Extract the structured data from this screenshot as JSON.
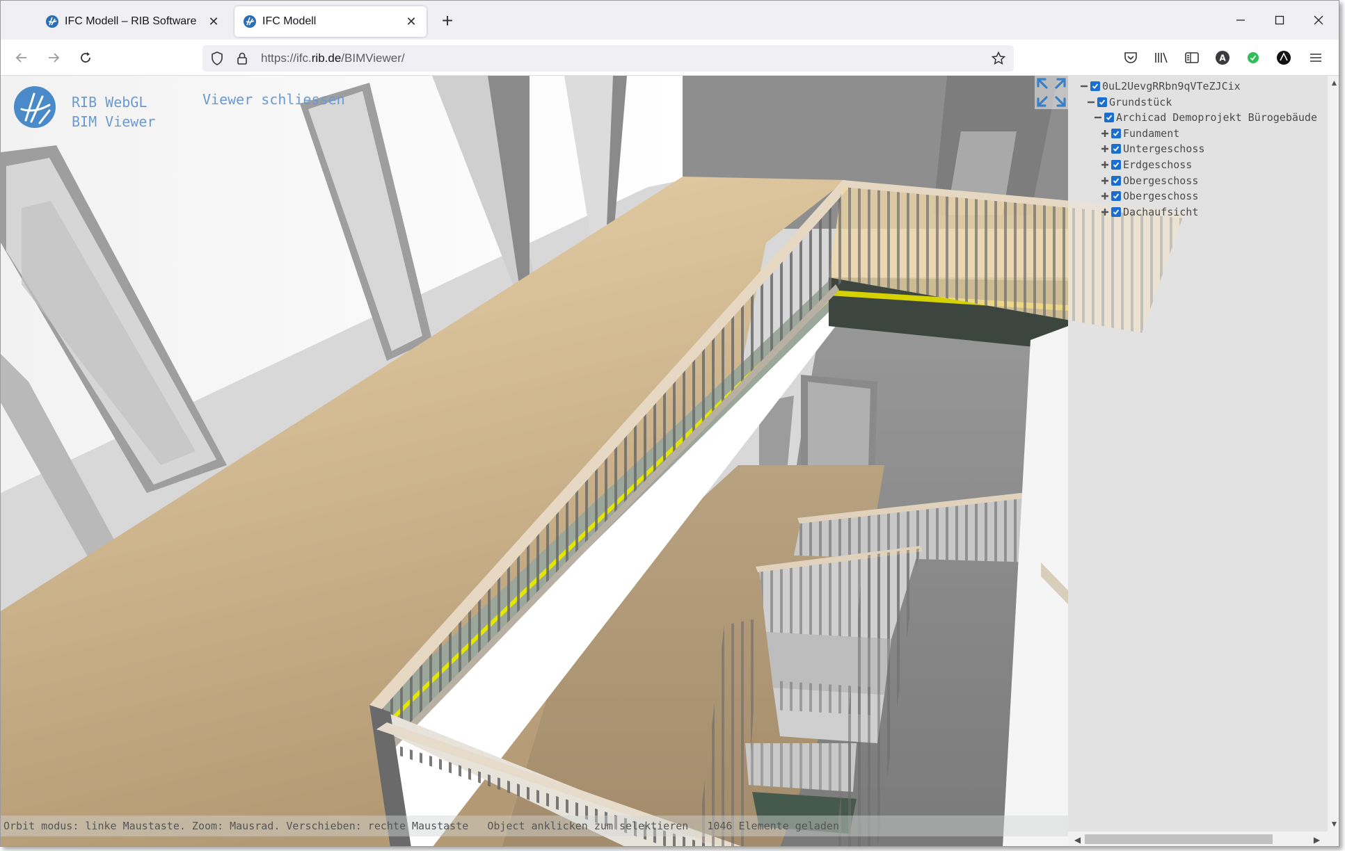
{
  "browser": {
    "tabs": [
      {
        "label": "IFC Modell – RIB Software",
        "active": false
      },
      {
        "label": "IFC Modell",
        "active": true
      }
    ],
    "url_host": "https://ifc.",
    "url_domain": "rib.de",
    "url_path": "/BIMViewer/",
    "toolbar_icons": [
      "pocket-icon",
      "library-icon",
      "sidebar-icon",
      "account-icon",
      "extension-icon",
      "profile-icon",
      "menu-icon"
    ]
  },
  "viewer": {
    "brand_line1": "RIB WebGL",
    "brand_line2": "BIM Viewer",
    "close_label": "Viewer schliessen",
    "accent_color": "#6a9ad0"
  },
  "tree": [
    {
      "label": "0uL2UevgRRbn9qVTeZJCix",
      "toggle": "−",
      "level": 0
    },
    {
      "label": "Grundstück",
      "toggle": "−",
      "level": 1
    },
    {
      "label": "Archicad Demoprojekt Bürogebäude",
      "toggle": "−",
      "level": 2
    },
    {
      "label": "Fundament",
      "toggle": "+",
      "level": 3
    },
    {
      "label": "Untergeschoss",
      "toggle": "+",
      "level": 3
    },
    {
      "label": "Erdgeschoss",
      "toggle": "+",
      "level": 3
    },
    {
      "label": "Obergeschoss",
      "toggle": "+",
      "level": 3
    },
    {
      "label": "Obergeschoss",
      "toggle": "+",
      "level": 3
    },
    {
      "label": "Dachaufsicht",
      "toggle": "+",
      "level": 3
    }
  ],
  "status": {
    "help": "Orbit modus: linke Maustaste. Zoom: Mausrad. Verschieben: rechte Maustaste",
    "hint": "Object anklicken zum selektieren",
    "count": "1046 Elemente geladen"
  }
}
